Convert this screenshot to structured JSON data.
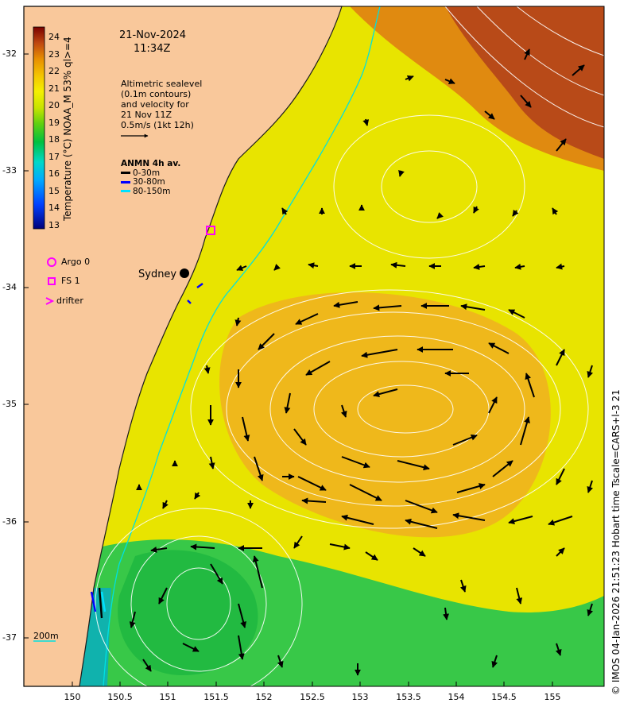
{
  "title": {
    "date": "21-Nov-2024",
    "time": "11:34Z"
  },
  "annotation_lines": [
    "Altimetric sealevel",
    "(0.1m contours)",
    "and velocity for",
    "21 Nov 11Z",
    "0.5m/s (1kt 12h)"
  ],
  "anmn_legend": {
    "title": "ANMN 4h av.",
    "items": [
      {
        "label": "0-30m",
        "color": "#000000"
      },
      {
        "label": "30-80m",
        "color": "#0000ff"
      },
      {
        "label": "80-150m",
        "color": "#00ffff"
      }
    ]
  },
  "colorbar": {
    "title": "Temperature (°C) NOAA_M 53% ql>=4",
    "ticks": [
      "24",
      "23",
      "22",
      "21",
      "20",
      "19",
      "18",
      "17",
      "16",
      "15",
      "14",
      "13"
    ],
    "colors": [
      "#000080",
      "#0030ff",
      "#00b0ff",
      "#00e0c0",
      "#00c040",
      "#60d000",
      "#c0e000",
      "#f0f000",
      "#f0c000",
      "#e88000",
      "#c04000",
      "#800000"
    ]
  },
  "symbols": [
    {
      "label": "Argo 0",
      "icon": "circle-icon",
      "color": "#ff00ff"
    },
    {
      "label": "FS 1",
      "icon": "square-icon",
      "color": "#ff00ff"
    },
    {
      "label": "drifter",
      "icon": "chevron-icon",
      "color": "#ff00ff"
    }
  ],
  "place_label": "Sydney",
  "isobath_label": "200m",
  "credit": "© IMOS 04-Jan-2026 21:51:23 Hobart time Tscale=CARS+l-3 21",
  "x_ticks": [
    "150",
    "150.5",
    "151",
    "151.5",
    "152",
    "152.5",
    "153",
    "153.5",
    "154",
    "154.5",
    "155"
  ],
  "y_ticks": [
    "-32",
    "-33",
    "-34",
    "-35",
    "-36",
    "-37"
  ],
  "colors": {
    "land": "#f9c89b",
    "coast": "#1a1a1a"
  }
}
